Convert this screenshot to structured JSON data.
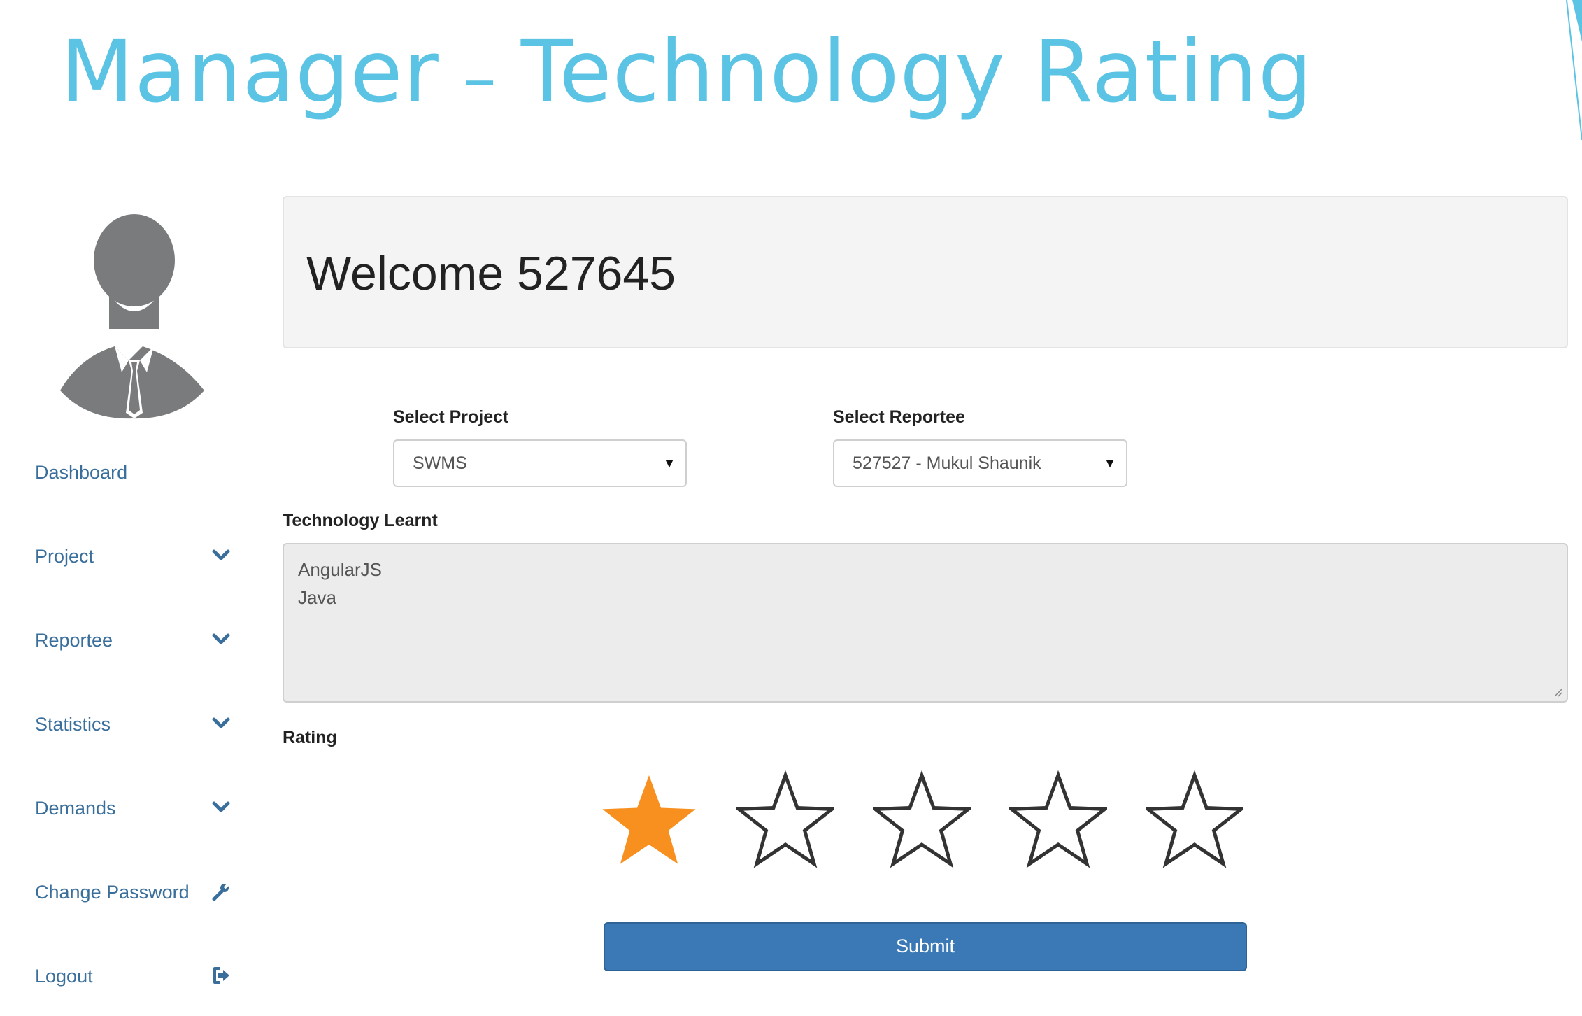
{
  "slide": {
    "title_part1": "Manager",
    "title_separator": "–",
    "title_part2": "Technology Rating"
  },
  "colors": {
    "title": "#5bc3e4",
    "link": "#3a6f9c",
    "button": "#3a79b5",
    "star_filled": "#f8901f",
    "star_outline": "#333333"
  },
  "sidebar": {
    "avatar_icon": "user-silhouette-icon",
    "items": [
      {
        "label": "Dashboard",
        "icon": ""
      },
      {
        "label": "Project",
        "icon": "chevron-down-icon"
      },
      {
        "label": "Reportee",
        "icon": "chevron-down-icon"
      },
      {
        "label": "Statistics",
        "icon": "chevron-down-icon"
      },
      {
        "label": "Demands",
        "icon": "chevron-down-icon"
      },
      {
        "label": "Change Password",
        "icon": "wrench-icon"
      },
      {
        "label": "Logout",
        "icon": "sign-out-icon"
      }
    ]
  },
  "main": {
    "welcome": "Welcome 527645",
    "select_project": {
      "label": "Select Project",
      "value": "SWMS"
    },
    "select_reportee": {
      "label": "Select Reportee",
      "value": "527527 - Mukul Shaunik"
    },
    "technology": {
      "label": "Technology Learnt",
      "lines": [
        "AngularJS",
        "Java"
      ]
    },
    "rating": {
      "label": "Rating",
      "value": 1,
      "max": 5
    },
    "submit_label": "Submit"
  }
}
